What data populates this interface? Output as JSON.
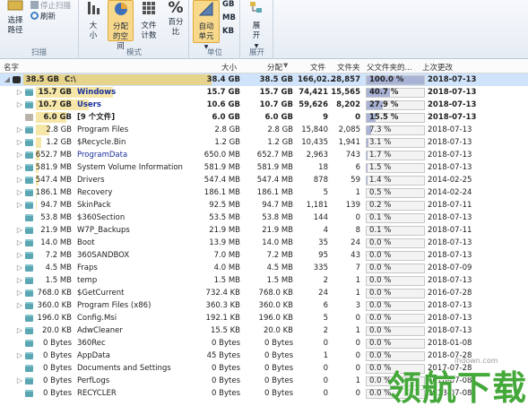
{
  "ribbon": {
    "groups": {
      "scan": {
        "label": "扫描",
        "select_path": "选择路径",
        "stop": "停止扫描",
        "refresh": "刷新"
      },
      "mode": {
        "label": "模式",
        "size": "大小",
        "allocated": "分配的空间",
        "file_count": "文件计数",
        "percent": "百分比"
      },
      "unit": {
        "label": "单位",
        "auto": "自动单元",
        "gb": "GB",
        "mb": "MB",
        "kb": "KB"
      },
      "expand": {
        "label": "展开",
        "expand": "展开"
      }
    }
  },
  "columns": {
    "name": "名字",
    "size": "大小",
    "allocated": "分配",
    "files": "文件",
    "folders": "文件夹",
    "percent_parent": "父文件夹的...",
    "last_modified": "上次更改"
  },
  "rows": [
    {
      "name": "C:\\",
      "sizecol": "38.5 GB",
      "size": "38.4 GB",
      "alloc": "38.5 GB",
      "files": "166,02...",
      "folders": "28,857",
      "pct": 100.0,
      "pct_text": "100.0 %",
      "date": "2018-07-13",
      "bold": true,
      "blue": false,
      "icon": "drive",
      "tw": "▲",
      "level": 0,
      "bar": 1.0
    },
    {
      "name": "Windows",
      "sizecol": "15.7 GB",
      "size": "15.7 GB",
      "alloc": "15.7 GB",
      "files": "74,421",
      "folders": "15,565",
      "pct": 40.7,
      "pct_text": "40.7 %",
      "date": "2018-07-13",
      "bold": true,
      "blue": true,
      "icon": "folder",
      "tw": "▷",
      "level": 1,
      "bar": 0.41
    },
    {
      "name": "Users",
      "sizecol": "10.7 GB",
      "size": "10.6 GB",
      "alloc": "10.7 GB",
      "files": "59,626",
      "folders": "8,202",
      "pct": 27.9,
      "pct_text": "27.9 %",
      "date": "2018-07-13",
      "bold": true,
      "blue": true,
      "icon": "folder",
      "tw": "▷",
      "level": 1,
      "bar": 0.28
    },
    {
      "name": "[9 个文件]",
      "sizecol": "6.0 GB",
      "size": "6.0 GB",
      "alloc": "6.0 GB",
      "files": "9",
      "folders": "0",
      "pct": 15.5,
      "pct_text": "15.5 %",
      "date": "2018-07-13",
      "bold": true,
      "blue": false,
      "icon": "files",
      "tw": "",
      "level": 1,
      "bar": 0.16
    },
    {
      "name": "Program Files",
      "sizecol": "2.8 GB",
      "size": "2.8 GB",
      "alloc": "2.8 GB",
      "files": "15,840",
      "folders": "2,085",
      "pct": 7.3,
      "pct_text": "7.3 %",
      "date": "2018-07-13",
      "bold": false,
      "blue": false,
      "icon": "folder",
      "tw": "▷",
      "level": 1,
      "bar": 0.07
    },
    {
      "name": "$Recycle.Bin",
      "sizecol": "1.2 GB",
      "size": "1.2 GB",
      "alloc": "1.2 GB",
      "files": "10,435",
      "folders": "1,941",
      "pct": 3.1,
      "pct_text": "3.1 %",
      "date": "2018-07-13",
      "bold": false,
      "blue": false,
      "icon": "folder",
      "tw": "▷",
      "level": 1,
      "bar": 0.03
    },
    {
      "name": "ProgramData",
      "sizecol": "652.7 MB",
      "size": "650.0 MB",
      "alloc": "652.7 MB",
      "files": "2,963",
      "folders": "743",
      "pct": 1.7,
      "pct_text": "1.7 %",
      "date": "2018-07-13",
      "bold": false,
      "blue": true,
      "icon": "folder",
      "tw": "▷",
      "level": 1,
      "bar": 0.017
    },
    {
      "name": "System Volume Information",
      "sizecol": "581.9 MB",
      "size": "581.9 MB",
      "alloc": "581.9 MB",
      "files": "18",
      "folders": "6",
      "pct": 1.5,
      "pct_text": "1.5 %",
      "date": "2018-07-13",
      "bold": false,
      "blue": false,
      "icon": "folder",
      "tw": "▷",
      "level": 1,
      "bar": 0.015
    },
    {
      "name": "Drivers",
      "sizecol": "547.4 MB",
      "size": "547.4 MB",
      "alloc": "547.4 MB",
      "files": "878",
      "folders": "59",
      "pct": 1.4,
      "pct_text": "1.4 %",
      "date": "2014-02-25",
      "bold": false,
      "blue": false,
      "icon": "folder",
      "tw": "▷",
      "level": 1,
      "bar": 0.014
    },
    {
      "name": "Recovery",
      "sizecol": "186.1 MB",
      "size": "186.1 MB",
      "alloc": "186.1 MB",
      "files": "5",
      "folders": "1",
      "pct": 0.5,
      "pct_text": "0.5 %",
      "date": "2014-02-24",
      "bold": false,
      "blue": false,
      "icon": "folder",
      "tw": "▷",
      "level": 1,
      "bar": 0.005
    },
    {
      "name": "SkinPack",
      "sizecol": "94.7 MB",
      "size": "92.5 MB",
      "alloc": "94.7 MB",
      "files": "1,181",
      "folders": "139",
      "pct": 0.2,
      "pct_text": "0.2 %",
      "date": "2018-07-11",
      "bold": false,
      "blue": false,
      "icon": "folder",
      "tw": "▷",
      "level": 1,
      "bar": 0.003
    },
    {
      "name": "$360Section",
      "sizecol": "53.8 MB",
      "size": "53.5 MB",
      "alloc": "53.8 MB",
      "files": "144",
      "folders": "0",
      "pct": 0.1,
      "pct_text": "0.1 %",
      "date": "2018-07-13",
      "bold": false,
      "blue": false,
      "icon": "folder",
      "tw": "",
      "level": 1,
      "bar": 0.002
    },
    {
      "name": "W7P_Backups",
      "sizecol": "21.9 MB",
      "size": "21.9 MB",
      "alloc": "21.9 MB",
      "files": "4",
      "folders": "8",
      "pct": 0.1,
      "pct_text": "0.1 %",
      "date": "2018-07-11",
      "bold": false,
      "blue": false,
      "icon": "folder",
      "tw": "▷",
      "level": 1,
      "bar": 0.001
    },
    {
      "name": "Boot",
      "sizecol": "14.0 MB",
      "size": "13.9 MB",
      "alloc": "14.0 MB",
      "files": "35",
      "folders": "24",
      "pct": 0.0,
      "pct_text": "0.0 %",
      "date": "2018-07-13",
      "bold": false,
      "blue": false,
      "icon": "folder",
      "tw": "▷",
      "level": 1,
      "bar": 0.0
    },
    {
      "name": "360SANDBOX",
      "sizecol": "7.2 MB",
      "size": "7.0 MB",
      "alloc": "7.2 MB",
      "files": "95",
      "folders": "43",
      "pct": 0.0,
      "pct_text": "0.0 %",
      "date": "2018-07-13",
      "bold": false,
      "blue": false,
      "icon": "folder",
      "tw": "▷",
      "level": 1,
      "bar": 0.0
    },
    {
      "name": "Fraps",
      "sizecol": "4.5 MB",
      "size": "4.0 MB",
      "alloc": "4.5 MB",
      "files": "335",
      "folders": "7",
      "pct": 0.0,
      "pct_text": "0.0 %",
      "date": "2018-07-09",
      "bold": false,
      "blue": false,
      "icon": "folder",
      "tw": "▷",
      "level": 1,
      "bar": 0.0
    },
    {
      "name": "temp",
      "sizecol": "1.5 MB",
      "size": "1.5 MB",
      "alloc": "1.5 MB",
      "files": "2",
      "folders": "1",
      "pct": 0.0,
      "pct_text": "0.0 %",
      "date": "2018-07-13",
      "bold": false,
      "blue": false,
      "icon": "folder",
      "tw": "▷",
      "level": 1,
      "bar": 0.0
    },
    {
      "name": "$GetCurrent",
      "sizecol": "768.0 KB",
      "size": "732.4 KB",
      "alloc": "768.0 KB",
      "files": "24",
      "folders": "1",
      "pct": 0.0,
      "pct_text": "0.0 %",
      "date": "2016-07-28",
      "bold": false,
      "blue": false,
      "icon": "folder",
      "tw": "▷",
      "level": 1,
      "bar": 0.0
    },
    {
      "name": "Program Files (x86)",
      "sizecol": "360.0 KB",
      "size": "360.3 KB",
      "alloc": "360.0 KB",
      "files": "6",
      "folders": "3",
      "pct": 0.0,
      "pct_text": "0.0 %",
      "date": "2018-07-13",
      "bold": false,
      "blue": false,
      "icon": "folder",
      "tw": "▷",
      "level": 1,
      "bar": 0.0
    },
    {
      "name": "Config.Msi",
      "sizecol": "196.0 KB",
      "size": "192.1 KB",
      "alloc": "196.0 KB",
      "files": "5",
      "folders": "0",
      "pct": 0.0,
      "pct_text": "0.0 %",
      "date": "2018-07-13",
      "bold": false,
      "blue": false,
      "icon": "folder",
      "tw": "",
      "level": 1,
      "bar": 0.0
    },
    {
      "name": "AdwCleaner",
      "sizecol": "20.0 KB",
      "size": "15.5 KB",
      "alloc": "20.0 KB",
      "files": "2",
      "folders": "1",
      "pct": 0.0,
      "pct_text": "0.0 %",
      "date": "2018-07-13",
      "bold": false,
      "blue": false,
      "icon": "folder",
      "tw": "▷",
      "level": 1,
      "bar": 0.0
    },
    {
      "name": "360Rec",
      "sizecol": "0 Bytes",
      "size": "0 Bytes",
      "alloc": "0 Bytes",
      "files": "0",
      "folders": "0",
      "pct": 0.0,
      "pct_text": "0.0 %",
      "date": "2018-01-08",
      "bold": false,
      "blue": false,
      "icon": "folder",
      "tw": "",
      "level": 1,
      "bar": 0.0
    },
    {
      "name": "AppData",
      "sizecol": "0 Bytes",
      "size": "45 Bytes",
      "alloc": "0 Bytes",
      "files": "1",
      "folders": "0",
      "pct": 0.0,
      "pct_text": "0.0 %",
      "date": "2018-07-28",
      "bold": false,
      "blue": false,
      "icon": "folder",
      "tw": "▷",
      "level": 1,
      "bar": 0.0
    },
    {
      "name": "Documents and Settings",
      "sizecol": "0 Bytes",
      "size": "0 Bytes",
      "alloc": "0 Bytes",
      "files": "0",
      "folders": "0",
      "pct": 0.0,
      "pct_text": "0.0 %",
      "date": "2017-07-28",
      "bold": false,
      "blue": false,
      "icon": "folder",
      "tw": "",
      "level": 1,
      "bar": 0.0
    },
    {
      "name": "PerfLogs",
      "sizecol": "0 Bytes",
      "size": "0 Bytes",
      "alloc": "0 Bytes",
      "files": "0",
      "folders": "1",
      "pct": 0.0,
      "pct_text": "0.0 %",
      "date": "2018-07-08",
      "bold": false,
      "blue": false,
      "icon": "folder",
      "tw": "▷",
      "level": 1,
      "bar": 0.0
    },
    {
      "name": "RECYCLER",
      "sizecol": "0 Bytes",
      "size": "0 Bytes",
      "alloc": "0 Bytes",
      "files": "0",
      "folders": "0",
      "pct": 0.0,
      "pct_text": "0.0 %",
      "date": "2018-07-08",
      "bold": false,
      "blue": false,
      "icon": "folder",
      "tw": "",
      "level": 1,
      "bar": 0.0
    }
  ],
  "watermark": {
    "brand": "领航下载",
    "url": "lhdown.com"
  },
  "colors": {
    "selected_row": "#cfe3fb",
    "pct_fill": "#a9b3d6",
    "size_bar": "#f6e7a8",
    "watermark": "#45a83a",
    "dir_blue": "#1a2f9a"
  }
}
